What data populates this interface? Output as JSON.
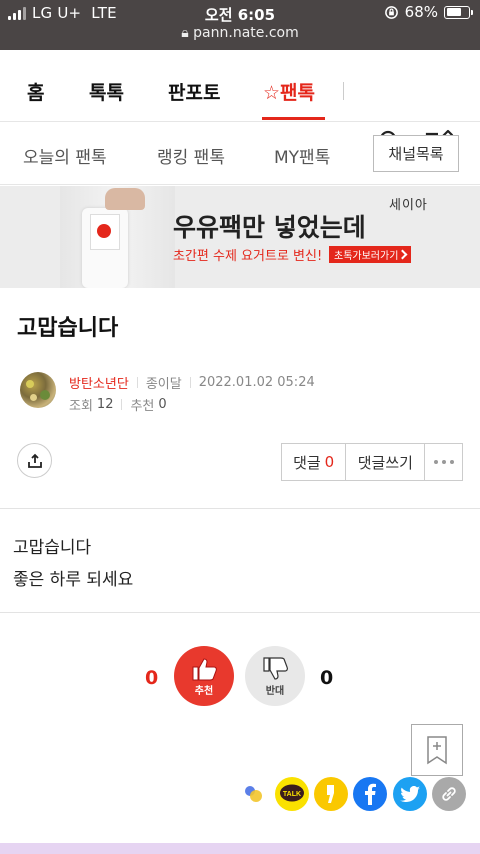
{
  "status_bar": {
    "carrier": "LG U+",
    "network": "LTE",
    "time": "오전 6:05",
    "battery": "68%",
    "url": "pann.nate.com"
  },
  "nav_main": {
    "items": [
      "홈",
      "톡톡",
      "판포토",
      "☆팬톡"
    ],
    "active": "☆팬톡"
  },
  "nav_sub": {
    "items": [
      "오늘의 팬톡",
      "랭킹 팬톡",
      "MY팬톡"
    ],
    "channel_button": "채널목록"
  },
  "banner": {
    "brand": "세이아",
    "title": "우유팩만 넣었는데",
    "subtitle": "초간편 수제 요거트로 변신!",
    "cta": "초톡가보러가기"
  },
  "post": {
    "title": "고맙습니다",
    "author": "방탄소년단",
    "level": "종이달",
    "datetime": "2022.01.02 05:24",
    "views_label": "조회",
    "views": "12",
    "recommend_label": "추천",
    "recommend": "0",
    "body": [
      "고맙습니다",
      "좋은 하루 되세요"
    ]
  },
  "actions": {
    "comment_label": "댓글",
    "comment_count": "0",
    "write_comment": "댓글쓰기"
  },
  "votes": {
    "up_count": "0",
    "up_label": "추천",
    "down_count": "0",
    "down_label": "반대"
  },
  "colors": {
    "accent": "#e4271b",
    "statusbar": "#4a4545",
    "kakao": "#fae100",
    "facebook": "#1877f2",
    "twitter": "#1da1f2"
  },
  "share_icons": [
    "band-icon",
    "kakaotalk-icon",
    "kakaostory-icon",
    "facebook-icon",
    "twitter-icon",
    "link-icon"
  ]
}
